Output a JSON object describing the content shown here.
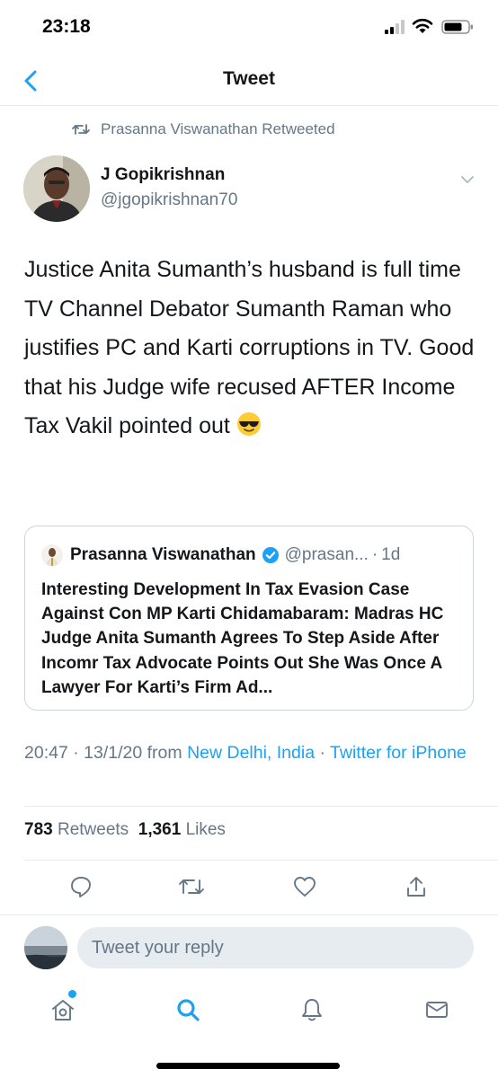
{
  "status_bar": {
    "time": "23:18"
  },
  "nav": {
    "title": "Tweet"
  },
  "retweet_context": {
    "text": "Prasanna Viswanathan Retweeted"
  },
  "author": {
    "name": "J Gopikrishnan",
    "handle": "@jgopikrishnan70"
  },
  "tweet": {
    "text": "Justice Anita Sumanth’s husband is full time TV Channel Debator Sumanth Raman who justifies PC and Karti corruptions in TV. Good that his Judge wife recused AFTER Income Tax Vakil pointed out",
    "emoji": "smiling-face-with-sunglasses"
  },
  "quoted_tweet": {
    "name": "Prasanna Viswanathan",
    "verified": true,
    "handle": "@prasan...",
    "separator": "·",
    "time": "1d",
    "text": "Interesting Development In Tax Evasion Case Against Con MP Karti Chidamabaram: Madras HC Judge Anita Sumanth Agrees To Step Aside After Incomr Tax Advocate Points Out She Was Once A Lawyer For Karti’s Firm Ad..."
  },
  "meta": {
    "time": "20:47",
    "dot1": " · ",
    "date": "13/1/20",
    "from": " from ",
    "location": "New Delhi, India",
    "dot2": " · ",
    "source": "Twitter for iPhone"
  },
  "stats": {
    "retweets_count": "783",
    "retweets_label": "Retweets",
    "likes_count": "1,361",
    "likes_label": "Likes"
  },
  "actions": [
    "reply-icon",
    "retweet-icon",
    "like-icon",
    "share-icon"
  ],
  "reply": {
    "placeholder": "Tweet your reply"
  },
  "tabs": [
    "home-icon",
    "search-icon",
    "notifications-icon",
    "messages-icon"
  ],
  "colors": {
    "accent": "#1da1f2",
    "secondary_text": "#657786",
    "primary_text": "#14171a",
    "border": "#e6ecf0"
  }
}
